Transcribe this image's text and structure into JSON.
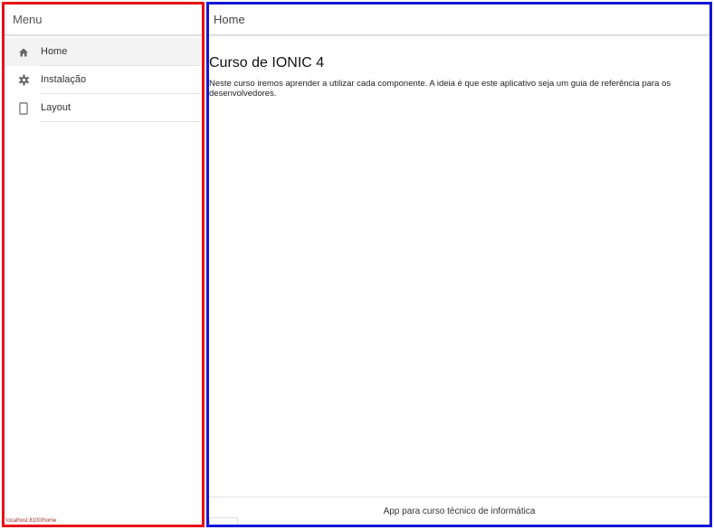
{
  "sidebar": {
    "title": "Menu",
    "items": [
      {
        "label": "Home",
        "icon": "home-icon",
        "active": true
      },
      {
        "label": "Instalação",
        "icon": "gear-icon",
        "active": false
      },
      {
        "label": "Layout",
        "icon": "tablet-icon",
        "active": false
      }
    ],
    "status_url": "localhost:8100/home"
  },
  "main": {
    "header_title": "Home",
    "heading": "Curso de IONIC 4",
    "paragraph": "Neste curso iremos aprender a utilizar cada componente. A ideia é que este aplicativo seja um guia de referência para os desenvolvedores.",
    "footer_text": "App para curso técnico de informática"
  },
  "colors": {
    "sidebar_border": "#e8101a",
    "main_border": "#1515d8",
    "icon": "#666666",
    "active_item_bg": "#f3f3f3"
  }
}
